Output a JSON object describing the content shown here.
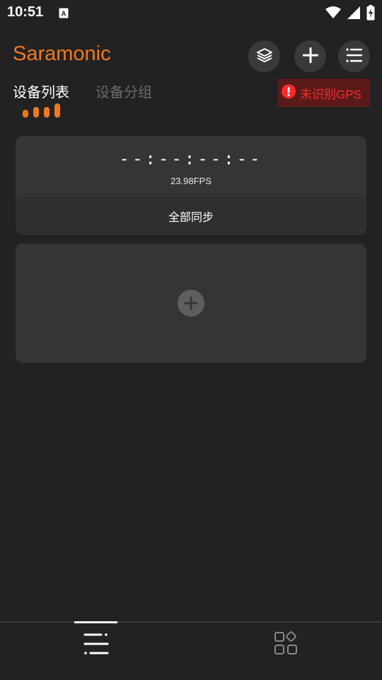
{
  "status_bar": {
    "time": "10:51",
    "notification_icon": "a-letter-icon",
    "icons": [
      "wifi-icon",
      "signal-icon",
      "battery-charging-icon"
    ]
  },
  "header": {
    "brand": "Saramonic",
    "buttons": [
      "layers-icon",
      "plus-icon",
      "menu-icon"
    ]
  },
  "tabs": [
    {
      "label": "设备列表",
      "active": true
    },
    {
      "label": "设备分组",
      "active": false
    }
  ],
  "gps_badge": {
    "label": "未识别GPS",
    "icon": "exclamation-icon",
    "color": "#ff2a2a"
  },
  "sync_card": {
    "timecode": "--:--:--:--",
    "fps": "23.98FPS",
    "action_label": "全部同步"
  },
  "add_device_card": {
    "icon": "plus-circle-icon"
  },
  "bottom_nav": {
    "items": [
      "list-icon",
      "apps-grid-icon"
    ],
    "active_index": 0
  },
  "colors": {
    "accent": "#f07a1a",
    "background": "#222222",
    "card": "#353535",
    "alert": "#ff2a2a"
  }
}
